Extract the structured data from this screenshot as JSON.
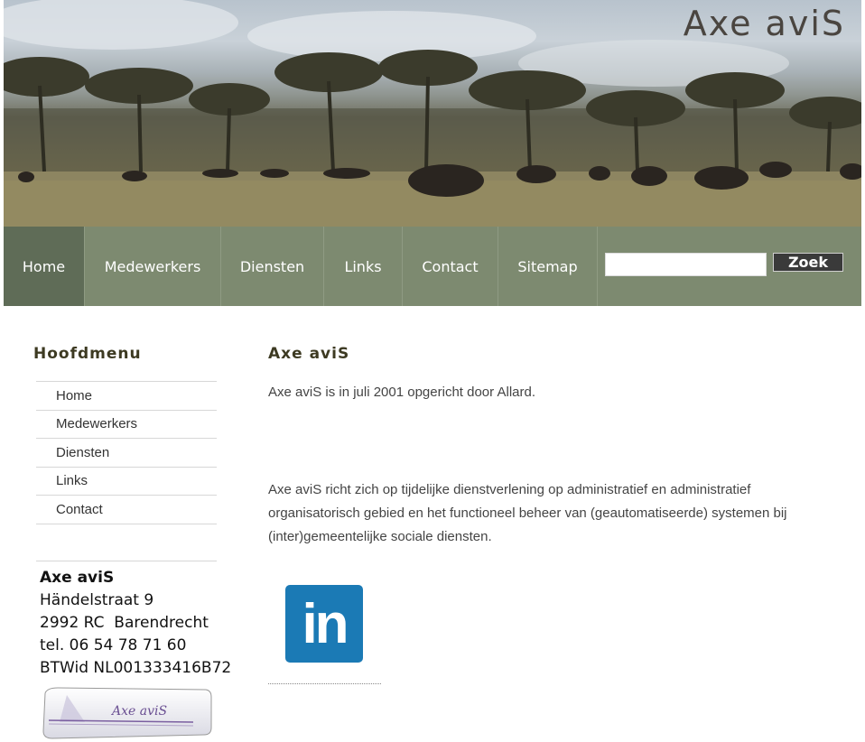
{
  "header": {
    "site_title": "Axe aviS"
  },
  "nav": {
    "items": [
      {
        "label": "Home",
        "active": true
      },
      {
        "label": "Medewerkers",
        "active": false
      },
      {
        "label": "Diensten",
        "active": false
      },
      {
        "label": "Links",
        "active": false
      },
      {
        "label": "Contact",
        "active": false
      },
      {
        "label": "Sitemap",
        "active": false
      }
    ],
    "search_value": "",
    "search_button_label": "Zoek"
  },
  "sidebar": {
    "title": "Hoofdmenu",
    "items": [
      {
        "label": "Home"
      },
      {
        "label": "Medewerkers"
      },
      {
        "label": "Diensten"
      },
      {
        "label": "Links"
      },
      {
        "label": "Contact"
      }
    ],
    "address": {
      "company": "Axe aviS",
      "street": "Händelstraat 9",
      "city": "2992 RC  Barendrecht",
      "phone": "tel. 06 54 78 71 60",
      "vat": "BTWid NL001333416B72"
    },
    "logo_text": "Axe aviS"
  },
  "main": {
    "title": "Axe aviS",
    "intro": "Axe aviS is in juli 2001 opgericht door Allard.",
    "description": "Axe aviS richt zich op tijdelijke dienstverlening op administratief en administratief organisatorisch gebied en het functioneel beheer van (geautomatiseerde) systemen bij (inter)gemeentelijke sociale diensten.",
    "linkedin_icon": "linkedin-icon",
    "linkedin_text": "in"
  },
  "colors": {
    "nav_bg": "#7d8a70",
    "nav_active": "#5f6c57",
    "heading": "#3d3a22",
    "linkedin": "#1b7ab5"
  }
}
